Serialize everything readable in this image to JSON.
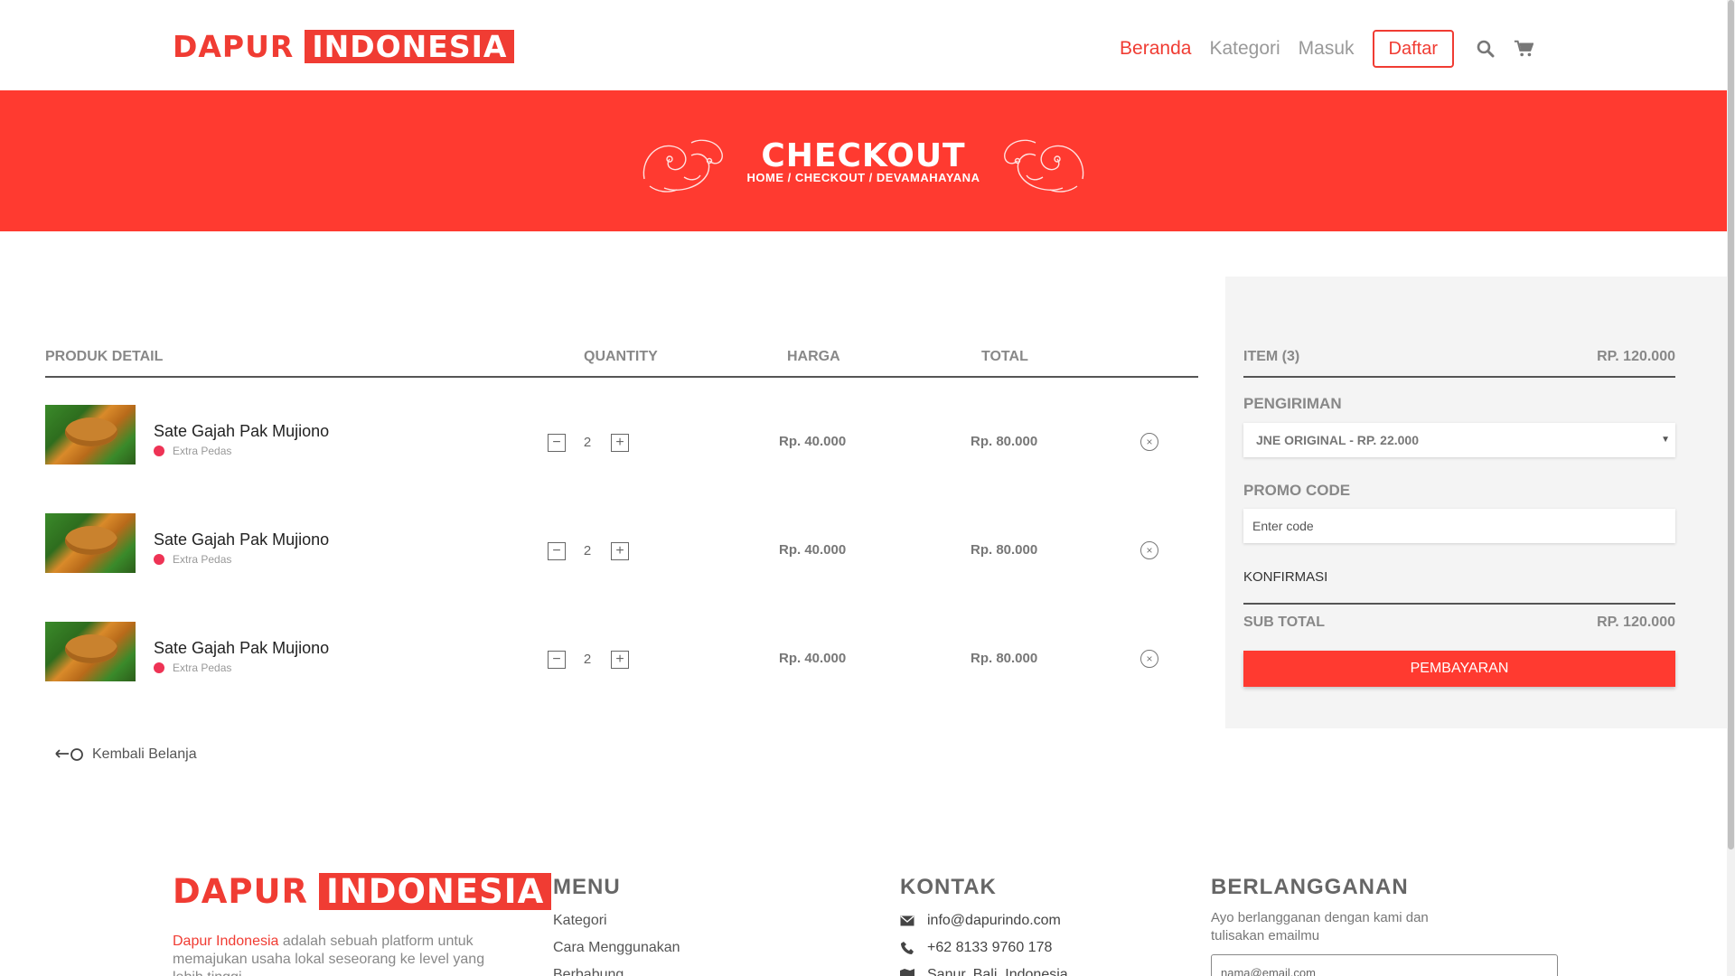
{
  "brand": {
    "word1": "DAPUR",
    "word2": "INDONESIA",
    "accent": "#f03c33"
  },
  "nav": {
    "links": [
      "Beranda",
      "Kategori",
      "Masuk"
    ],
    "active": "Beranda",
    "register_label": "Daftar",
    "icons": [
      "search-icon",
      "cart-icon"
    ]
  },
  "hero": {
    "title": "CHECKOUT",
    "breadcrumb": "HOME / CHECKOUT / DEVAMAHAYANA",
    "background": "#ff3a30"
  },
  "cart": {
    "headers": {
      "product": "PRODUK DETAIL",
      "quantity": "QUANTITY",
      "price": "HARGA",
      "total": "TOTAL"
    },
    "items": [
      {
        "name": "Sate Gajah Pak Mujiono",
        "variant": "Extra Pedas",
        "qty": "2",
        "price": "Rp. 40.000",
        "total": "Rp. 80.000"
      },
      {
        "name": "Sate Gajah Pak Mujiono",
        "variant": "Extra Pedas",
        "qty": "2",
        "price": "Rp. 40.000",
        "total": "Rp. 80.000"
      },
      {
        "name": "Sate Gajah Pak Mujiono",
        "variant": "Extra Pedas",
        "qty": "2",
        "price": "Rp. 40.000",
        "total": "Rp. 80.000"
      }
    ],
    "qty_minus": "−",
    "qty_plus": "+",
    "remove_glyph": "×",
    "back_label": "Kembali Belanja"
  },
  "summary": {
    "items_label": "ITEM (3)",
    "items_value": "RP. 120.000",
    "shipping_label": "PENGIRIMAN",
    "shipping_selected": "JNE ORIGINAL - RP. 22.000",
    "promo_label": "PROMO CODE",
    "promo_placeholder": "Enter code",
    "confirm_label": "KONFIRMASI",
    "subtotal_label": "SUB TOTAL",
    "subtotal_value": "RP. 120.000",
    "pay_label": "PEMBAYARAN"
  },
  "footer": {
    "about_highlight": "Dapur Indonesia",
    "about_text": " adalah sebuah platform untuk memajukan usaha lokal seseorang ke level yang lebih tinggi",
    "menu_title": "MENU",
    "menu_links": [
      "Kategori",
      "Cara Menggunakan",
      "Berbabung"
    ],
    "contact_title": "KONTAK",
    "contact": [
      {
        "icon": "envelope-icon",
        "text": "info@dapurindo.com"
      },
      {
        "icon": "phone-icon",
        "text": "+62 8133 9760 178"
      },
      {
        "icon": "map-icon",
        "text": "Sanur, Bali, Indonesia"
      }
    ],
    "subscribe_title": "BERLANGGANAN",
    "subscribe_text": "Ayo berlangganan dengan kami dan tulisakan emailmu",
    "email_placeholder": "nama@email.com"
  }
}
